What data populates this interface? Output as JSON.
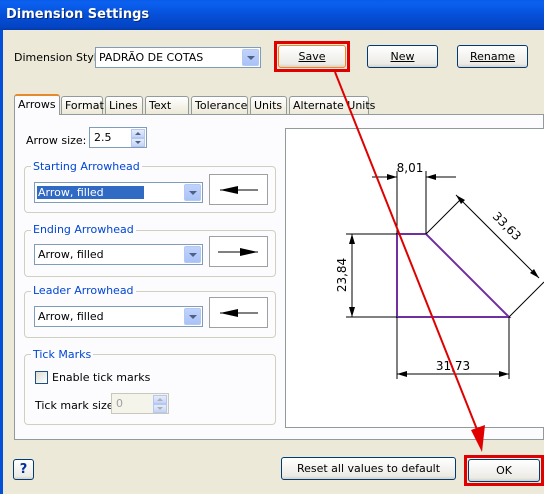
{
  "window": {
    "title": "Dimension Settings"
  },
  "style_row": {
    "label": "Dimension Style:",
    "selected": "PADRÃO DE COTAS",
    "save_label": "Save",
    "new_label": "New",
    "rename_label": "Rename"
  },
  "tabs": [
    {
      "label": "Arrows",
      "active": true
    },
    {
      "label": "Format"
    },
    {
      "label": "Lines"
    },
    {
      "label": "Text"
    },
    {
      "label": "Tolerance"
    },
    {
      "label": "Units"
    },
    {
      "label": "Alternate Units"
    }
  ],
  "arrows": {
    "arrow_size_label": "Arrow size:",
    "arrow_size_value": "2.5",
    "starting": {
      "title": "Starting Arrowhead",
      "selected": "Arrow, filled"
    },
    "ending": {
      "title": "Ending Arrowhead",
      "selected": "Arrow, filled"
    },
    "leader": {
      "title": "Leader Arrowhead",
      "selected": "Arrow, filled"
    }
  },
  "tick_marks": {
    "title": "Tick Marks",
    "enable_label": "Enable tick marks",
    "enabled": false,
    "size_label": "Tick mark size:",
    "size_value": "0"
  },
  "preview": {
    "dim_top": "8,01",
    "dim_diagonal": "33,63",
    "dim_left": "23,84",
    "dim_bottom": "31,73",
    "shape_color": "#7030a0"
  },
  "footer": {
    "help_label": "?",
    "reset_label": "Reset all values to default",
    "ok_label": "OK"
  },
  "annotation": {
    "highlight_color": "#e00000"
  }
}
